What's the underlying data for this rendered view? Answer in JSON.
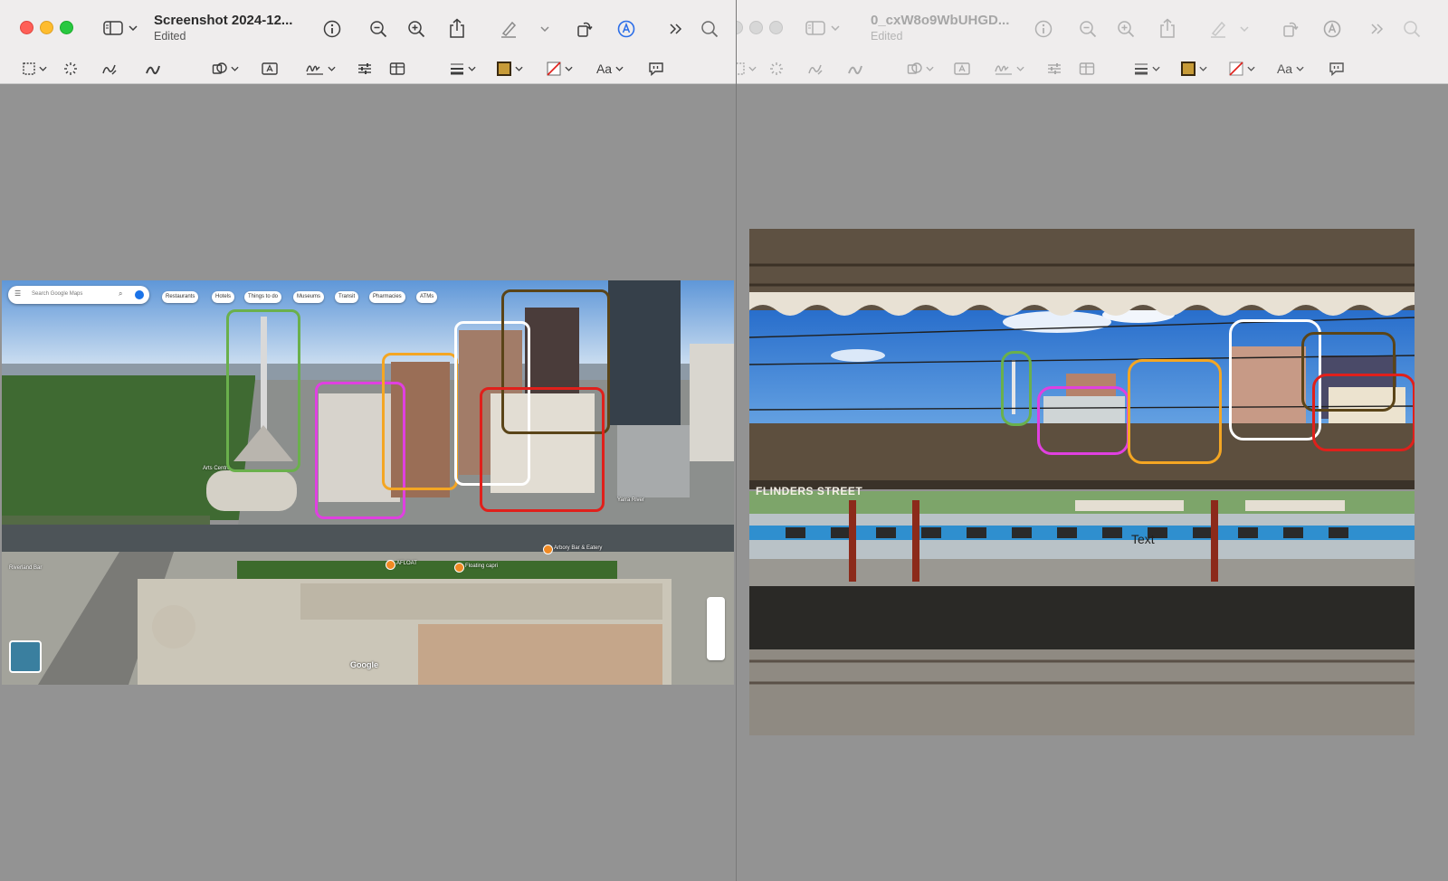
{
  "left_window": {
    "title": "Screenshot 2024-12...",
    "subtitle": "Edited",
    "photo": {
      "search_placeholder": "Search Google Maps",
      "chips": [
        "Restaurants",
        "Hotels",
        "Things to do",
        "Museums",
        "Transit",
        "Pharmacies",
        "ATMs"
      ],
      "places": [
        "Arts Centre",
        "Arbory Bar & Eatery",
        "AFLOAT",
        "Floating capri",
        "Riverland Bar",
        "Yarra River"
      ],
      "brand": "Google"
    }
  },
  "right_window": {
    "title": "0_cxW8o9WbUHGD...",
    "subtitle": "Edited",
    "photo": {
      "station_sign": "FLINDERS STREET",
      "text_annotation": "Text"
    }
  },
  "toolbar_icons": [
    "sidebar-icon",
    "info-icon",
    "zoom-out-icon",
    "zoom-in-icon",
    "share-icon",
    "highlight-icon",
    "rotate-icon",
    "markup-icon",
    "more-icon",
    "search-icon"
  ],
  "markup_icons": [
    "selection-icon",
    "instant-alpha-icon",
    "sketch-icon",
    "draw-icon",
    "shapes-icon",
    "text-box-icon",
    "sign-icon",
    "adjust-color-icon",
    "page-layout-icon",
    "line-style-icon",
    "border-color-icon",
    "fill-color-icon",
    "font-icon",
    "note-icon"
  ],
  "box_colors": {
    "green": "#6ab04c",
    "magenta": "#e040e0",
    "orange": "#f4a623",
    "white": "#ffffff",
    "brown": "#5a4418",
    "red": "#e0201b"
  }
}
